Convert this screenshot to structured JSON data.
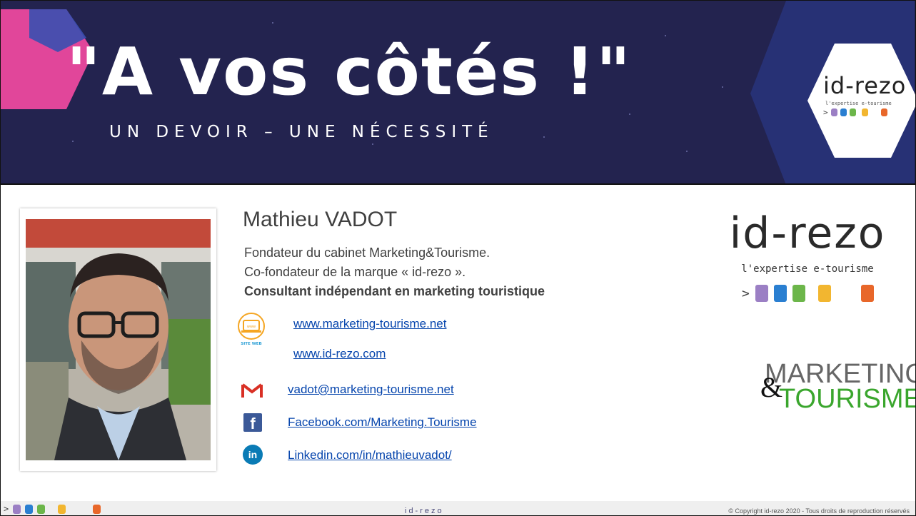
{
  "banner": {
    "title": "\"A vos côtés !\"",
    "subtitle": "UN DEVOIR – UNE NÉCESSITÉ",
    "badge_logo": "id-rezo",
    "badge_tagline": "l'expertise e-tourisme"
  },
  "contact": {
    "name": "Mathieu VADOT",
    "line1": "Fondateur du cabinet Marketing&Tourisme.",
    "line2": "Co-fondateur de la marque « id-rezo ».",
    "line3": "Consultant indépendant en marketing touristique",
    "website_icon_caption": "SITE WEB",
    "website_icon_text": "www",
    "links": [
      {
        "label": "www.marketing-tourisme.net"
      },
      {
        "label": "www.id-rezo.com"
      },
      {
        "label": "vadot@marketing-tourisme.net"
      },
      {
        "label": "Facebook.com/Marketing.Tourisme"
      },
      {
        "label": "Linkedin.com/in/mathieuvadot/"
      }
    ],
    "facebook_glyph": "f",
    "linkedin_glyph": "in"
  },
  "logos": {
    "idrezo": "id-rezo",
    "idrezo_tagline": "l'expertise e-tourisme",
    "marketing_top": "ARKETING",
    "marketing_m": "M",
    "marketing_amp": "&",
    "marketing_bottom": "TOURISME"
  },
  "footer": {
    "center": "id-rezo",
    "copyright": "© Copyright id-rezo 2020 - Tous droits de reproduction réservés"
  },
  "colors": {
    "banner_bg": "#23234f",
    "hex_pink": "#e1469a",
    "hex_blue": "#2c3e95",
    "square_purple": "#9b7fc4",
    "square_blue": "#2a7fd1",
    "square_green": "#6cb64a",
    "square_yellow": "#f2b630",
    "square_orange": "#e8672a",
    "link": "#0645ad",
    "marketing_green": "#3aa62d"
  },
  "icons": [
    "website-icon",
    "gmail-icon",
    "facebook-icon",
    "linkedin-icon"
  ]
}
